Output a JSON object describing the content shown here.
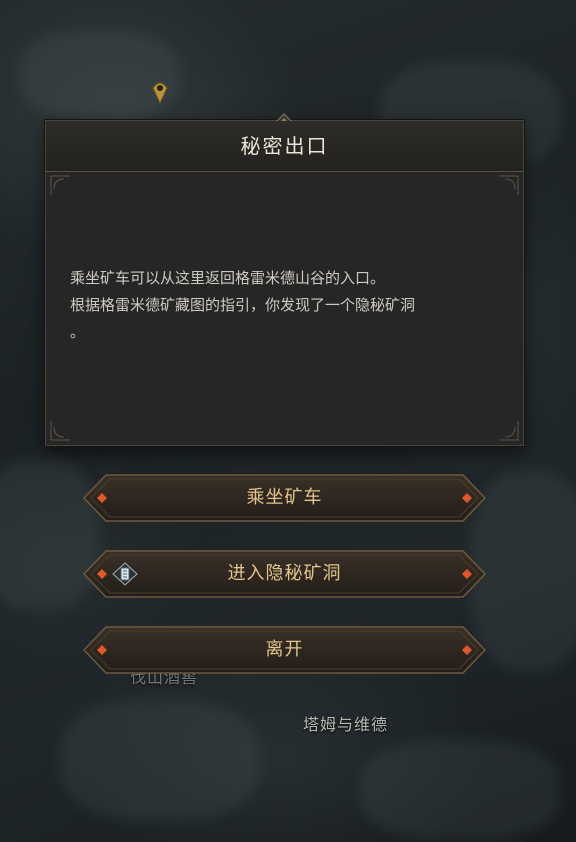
{
  "dialog": {
    "title": "秘密出口",
    "body_lines": [
      "乘坐矿车可以从这里返回格雷米德山谷的入口。",
      "根据格雷米德矿藏图的指引，你发现了一个隐秘矿洞",
      "。"
    ]
  },
  "options": [
    {
      "label": "乘坐矿车"
    },
    {
      "label": "进入隐秘矿洞",
      "icon": "scroll-icon"
    },
    {
      "label": "离开"
    }
  ],
  "map": {
    "labels": [
      "塔姆与维德",
      "伐山酒窖"
    ]
  },
  "colors": {
    "accent_gold": "#e2c58c",
    "ember": "#e0572a",
    "panel": "#262626"
  }
}
